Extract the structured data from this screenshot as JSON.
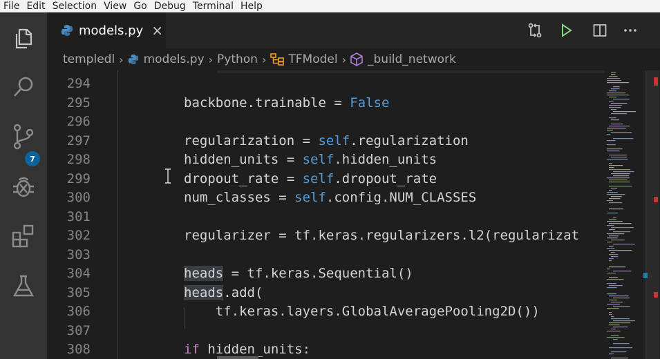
{
  "menu": [
    "File",
    "Edit",
    "Selection",
    "View",
    "Go",
    "Debug",
    "Terminal",
    "Help"
  ],
  "activity_bar": {
    "icons": [
      "files-icon",
      "search-icon",
      "source-control-icon",
      "debug-icon",
      "extensions-icon",
      "test-flask-icon"
    ],
    "scm_badge": "7"
  },
  "tab": {
    "filename": "models.py",
    "close": "×"
  },
  "breadcrumb": {
    "folder": "templedl",
    "file": "models.py",
    "language": "Python",
    "class": "TFModel",
    "method": "_build_network"
  },
  "editor": {
    "lines": [
      {
        "num": "294",
        "segments": []
      },
      {
        "num": "295",
        "segments": [
          {
            "t": "backbone.trainable = "
          },
          {
            "t": "False",
            "c": "kw"
          }
        ]
      },
      {
        "num": "296",
        "segments": []
      },
      {
        "num": "297",
        "segments": [
          {
            "t": "regularization = "
          },
          {
            "t": "self",
            "c": "kw"
          },
          {
            "t": ".regularization"
          }
        ]
      },
      {
        "num": "298",
        "segments": [
          {
            "t": "hidden_units = "
          },
          {
            "t": "self",
            "c": "kw"
          },
          {
            "t": ".hidden_units"
          }
        ]
      },
      {
        "num": "299",
        "segments": [
          {
            "t": "dropout_rate = "
          },
          {
            "t": "self",
            "c": "kw"
          },
          {
            "t": ".dropout_rate"
          }
        ]
      },
      {
        "num": "300",
        "segments": [
          {
            "t": "num_classes = "
          },
          {
            "t": "self",
            "c": "kw"
          },
          {
            "t": ".config.NUM_CLASSES"
          }
        ]
      },
      {
        "num": "301",
        "segments": []
      },
      {
        "num": "302",
        "segments": [
          {
            "t": "regularizer = tf.keras.regularizers.l2(regularizat"
          }
        ]
      },
      {
        "num": "303",
        "segments": []
      },
      {
        "num": "304",
        "segments": [
          {
            "t": "heads",
            "c": "hl"
          },
          {
            "t": " = tf.keras.Sequential()"
          }
        ]
      },
      {
        "num": "305",
        "segments": [
          {
            "t": "heads",
            "c": "hl"
          },
          {
            "t": ".add("
          }
        ]
      },
      {
        "num": "306",
        "segments": [
          {
            "t": "    tf.keras.layers.GlobalAveragePooling2D())"
          }
        ]
      },
      {
        "num": "307",
        "segments": []
      },
      {
        "num": "308",
        "segments": [
          {
            "t": "if",
            "c": "kw2"
          },
          {
            "t": " hidden_units:"
          }
        ]
      }
    ]
  },
  "colors": {
    "keyword": "#569cd6",
    "control": "#c586c0",
    "text": "#d4d4d4",
    "linenum": "#858585",
    "accent": "#0e639c"
  }
}
